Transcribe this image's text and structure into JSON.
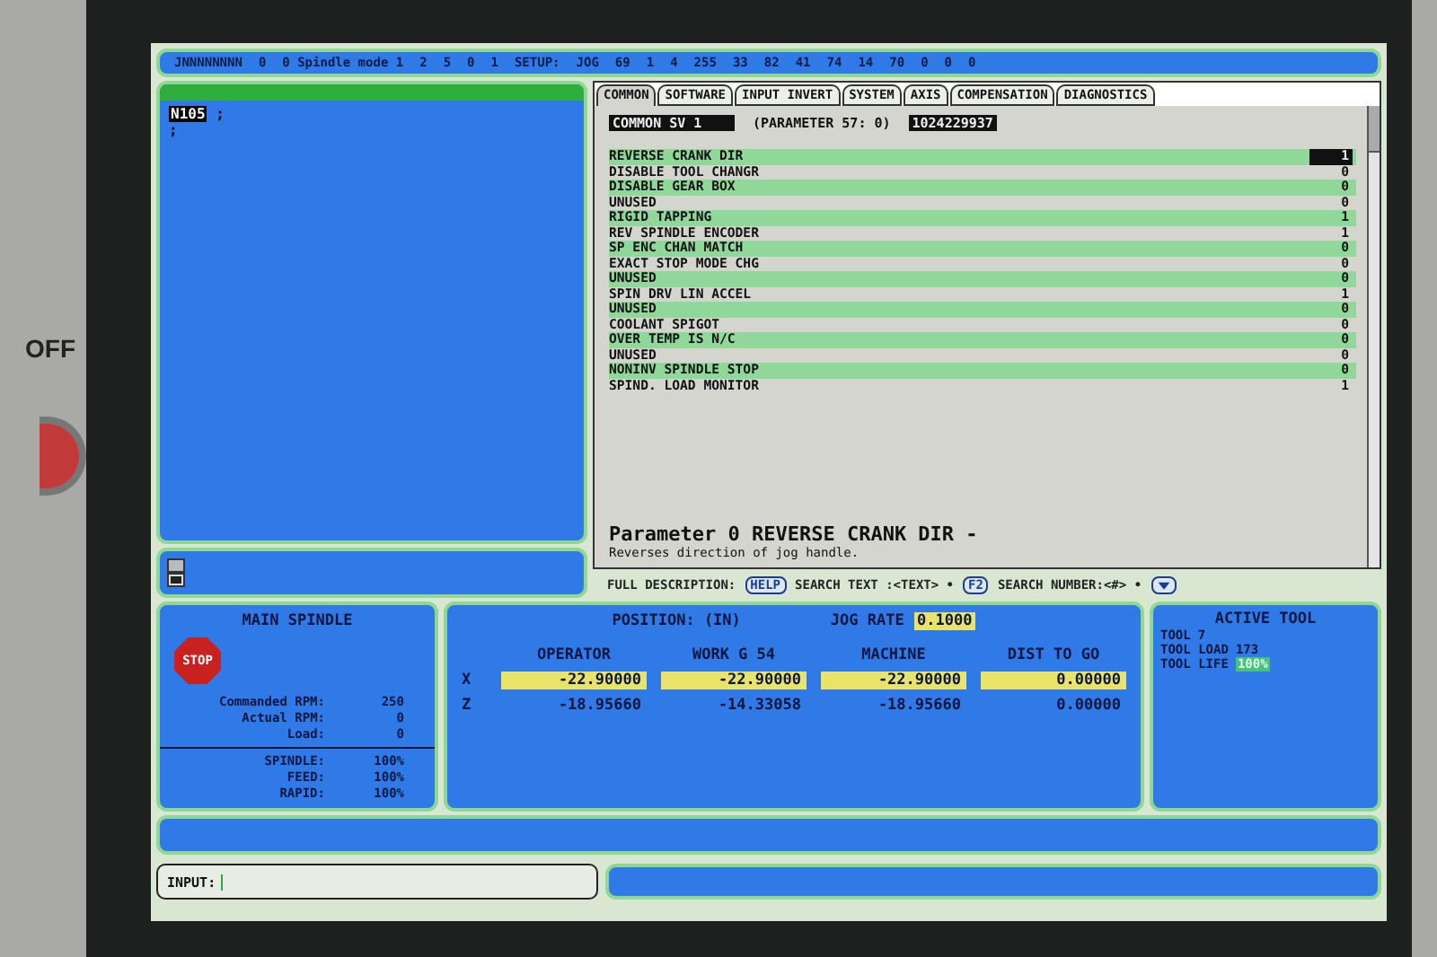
{
  "machine_panel": {
    "label": "OFF"
  },
  "status_bar": {
    "items": [
      "JNNNNNNNN",
      "0",
      "0 Spindle mode 1",
      "2",
      "5",
      "0",
      "1",
      "SETUP:",
      "JOG",
      "69",
      "1",
      "4",
      "255",
      "33",
      "82",
      "41",
      "74",
      "14",
      "70",
      "0",
      "0",
      "0"
    ]
  },
  "program": {
    "block": "N105",
    "line_end": ";",
    "lines": [
      ";"
    ]
  },
  "settings": {
    "tabs": [
      {
        "label": "COMMON",
        "selected": true
      },
      {
        "label": "SOFTWARE",
        "selected": false
      },
      {
        "label": "INPUT INVERT",
        "selected": false
      },
      {
        "label": "SYSTEM",
        "selected": false
      },
      {
        "label": "AXIS",
        "selected": false
      },
      {
        "label": "COMPENSATION",
        "selected": false
      },
      {
        "label": "DIAGNOSTICS",
        "selected": false
      }
    ],
    "group": "COMMON SV 1",
    "parameter": "(PARAMETER  57: 0)",
    "raw_value": "1024229937",
    "rows": [
      {
        "name": "REVERSE CRANK DIR",
        "value": "1",
        "selected": true
      },
      {
        "name": "DISABLE TOOL CHANGR",
        "value": "0",
        "selected": false
      },
      {
        "name": "DISABLE GEAR BOX",
        "value": "0",
        "selected": false
      },
      {
        "name": "UNUSED",
        "value": "0",
        "selected": false
      },
      {
        "name": "RIGID TAPPING",
        "value": "1",
        "selected": false
      },
      {
        "name": "REV SPINDLE ENCODER",
        "value": "1",
        "selected": false
      },
      {
        "name": "SP ENC CHAN MATCH",
        "value": "0",
        "selected": false
      },
      {
        "name": "EXACT STOP MODE CHG",
        "value": "0",
        "selected": false
      },
      {
        "name": "UNUSED",
        "value": "0",
        "selected": false
      },
      {
        "name": "SPIN DRV LIN ACCEL",
        "value": "1",
        "selected": false
      },
      {
        "name": "UNUSED",
        "value": "0",
        "selected": false
      },
      {
        "name": "COOLANT SPIGOT",
        "value": "0",
        "selected": false
      },
      {
        "name": "OVER TEMP IS N/C",
        "value": "0",
        "selected": false
      },
      {
        "name": "UNUSED",
        "value": "0",
        "selected": false
      },
      {
        "name": "NONINV SPINDLE STOP",
        "value": "0",
        "selected": false
      },
      {
        "name": "SPIND. LOAD MONITOR",
        "value": "1",
        "selected": false
      }
    ],
    "description_title": "Parameter 0 REVERSE CRANK DIR -",
    "description": "Reverses direction of jog handle."
  },
  "help_bar": {
    "full_label": "FULL DESCRIPTION:",
    "help_key": "HELP",
    "search_text_label": "SEARCH TEXT :<TEXT> •",
    "search_text_key": "F2",
    "search_number_label": "SEARCH NUMBER:<#> •"
  },
  "main_spindle": {
    "title": "MAIN SPINDLE",
    "stop": "STOP",
    "readings": [
      {
        "label": "Commanded RPM:",
        "value": "250"
      },
      {
        "label": "Actual RPM:",
        "value": "0"
      },
      {
        "label": "Load:",
        "value": "0"
      }
    ],
    "overrides": [
      {
        "label": "SPINDLE:",
        "value": "100%"
      },
      {
        "label": "FEED:",
        "value": "100%"
      },
      {
        "label": "RAPID:",
        "value": "100%"
      }
    ]
  },
  "position": {
    "title": "POSITION: (IN)",
    "jog_label": "JOG RATE",
    "jog_rate": "0.1000",
    "columns": [
      "OPERATOR",
      "WORK G 54",
      "MACHINE",
      "DIST TO GO"
    ],
    "rows": [
      {
        "axis": "X",
        "selected": true,
        "values": [
          "-22.90000",
          "-22.90000",
          "-22.90000",
          "0.00000"
        ]
      },
      {
        "axis": "Z",
        "selected": false,
        "values": [
          "-18.95660",
          "-14.33058",
          "-18.95660",
          "0.00000"
        ]
      }
    ]
  },
  "active_tool": {
    "title": "ACTIVE TOOL",
    "lines": [
      {
        "kind": "plain",
        "label": "TOOL",
        "value": "7"
      },
      {
        "kind": "plain",
        "label": "TOOL LOAD",
        "value": "173"
      },
      {
        "kind": "badge",
        "label": "TOOL LIFE",
        "value": "100%"
      }
    ]
  },
  "input": {
    "label": "INPUT:"
  }
}
